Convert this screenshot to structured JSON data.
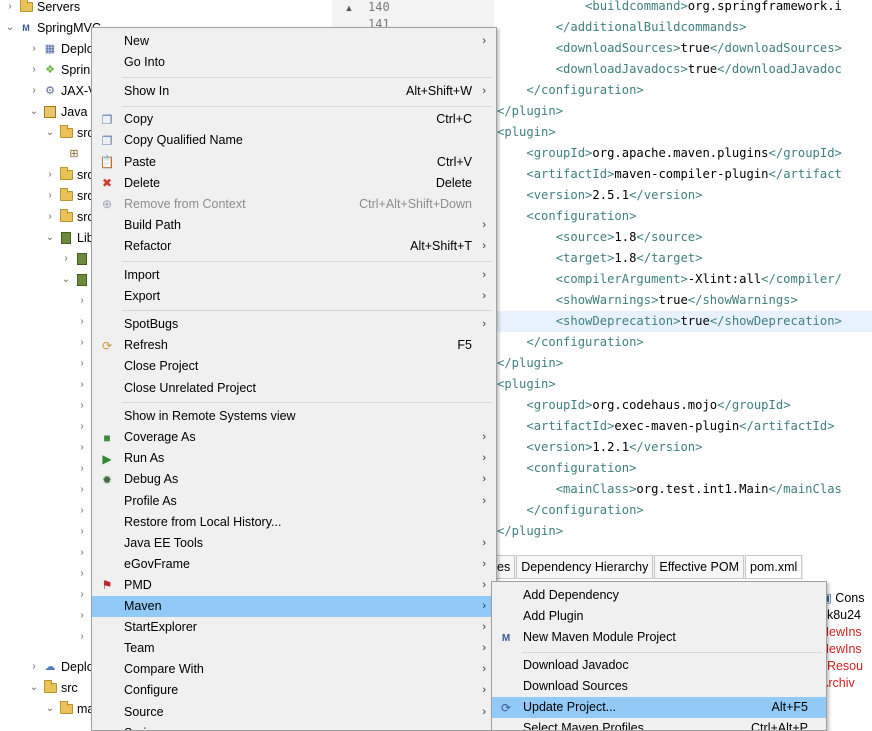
{
  "explorer": {
    "rows": [
      {
        "label": "Servers",
        "icon": "folder-icon"
      },
      {
        "label": "SpringMVC",
        "icon": "maven-project-icon"
      },
      {
        "label": "Deplo",
        "icon": "deployment-icon"
      },
      {
        "label": "Sprin",
        "icon": "spring-icon"
      },
      {
        "label": "JAX-V",
        "icon": "jaxws-icon"
      },
      {
        "label": "Java I",
        "icon": "java-resources-icon"
      },
      {
        "label": "src",
        "icon": "source-folder-icon"
      },
      {
        "label": "src",
        "icon": "source-folder-icon"
      },
      {
        "label": "src",
        "icon": "source-folder-icon"
      },
      {
        "label": "src",
        "icon": "source-folder-icon"
      },
      {
        "label": "Lib",
        "icon": "libraries-icon"
      },
      {
        "label": "Deplo",
        "icon": "deployed-resources-icon"
      },
      {
        "label": "src",
        "icon": "folder-icon"
      },
      {
        "label": "ma",
        "icon": "folder-icon"
      }
    ]
  },
  "editor": {
    "line_numbers": [
      "140",
      "141"
    ],
    "code_lines": [
      {
        "indent": "            ",
        "tag_open": "<buildcommand>",
        "text": "org.springframework.i",
        "tag_close": ""
      },
      {
        "indent": "        ",
        "tag_open": "</additionalBuildcommands>",
        "text": "",
        "tag_close": ""
      },
      {
        "indent": "        ",
        "tag_open": "<downloadSources>",
        "text": "true",
        "tag_close": "</downloadSources>"
      },
      {
        "indent": "        ",
        "tag_open": "<downloadJavadocs>",
        "text": "true",
        "tag_close": "</downloadJavadoc"
      },
      {
        "indent": "    ",
        "tag_open": "</configuration>",
        "text": "",
        "tag_close": ""
      },
      {
        "indent": "",
        "tag_open": "</plugin>",
        "text": "",
        "tag_close": ""
      },
      {
        "indent": "",
        "tag_open": "<plugin>",
        "text": "",
        "tag_close": ""
      },
      {
        "indent": "    ",
        "tag_open": "<groupId>",
        "text": "org.apache.maven.plugins",
        "tag_close": "</groupId>"
      },
      {
        "indent": "    ",
        "tag_open": "<artifactId>",
        "text": "maven-compiler-plugin",
        "tag_close": "</artifact"
      },
      {
        "indent": "    ",
        "tag_open": "<version>",
        "text": "2.5.1",
        "tag_close": "</version>"
      },
      {
        "indent": "    ",
        "tag_open": "<configuration>",
        "text": "",
        "tag_close": ""
      },
      {
        "indent": "        ",
        "tag_open": "<source>",
        "text": "1.8",
        "tag_close": "</source>"
      },
      {
        "indent": "        ",
        "tag_open": "<target>",
        "text": "1.8",
        "tag_close": "</target>"
      },
      {
        "indent": "        ",
        "tag_open": "<compilerArgument>",
        "text": "-Xlint:all",
        "tag_close": "</compiler/"
      },
      {
        "indent": "        ",
        "tag_open": "<showWarnings>",
        "text": "true",
        "tag_close": "</showWarnings>"
      },
      {
        "indent": "        ",
        "tag_open": "<showDeprecation>",
        "text": "true",
        "tag_close": "</showDeprecation>"
      },
      {
        "indent": "    ",
        "tag_open": "</configuration>",
        "text": "",
        "tag_close": ""
      },
      {
        "indent": "",
        "tag_open": "</plugin>",
        "text": "",
        "tag_close": ""
      },
      {
        "indent": "",
        "tag_open": "<plugin>",
        "text": "",
        "tag_close": ""
      },
      {
        "indent": "    ",
        "tag_open": "<groupId>",
        "text": "org.codehaus.mojo",
        "tag_close": "</groupId>"
      },
      {
        "indent": "    ",
        "tag_open": "<artifactId>",
        "text": "exec-maven-plugin",
        "tag_close": "</artifactId>"
      },
      {
        "indent": "    ",
        "tag_open": "<version>",
        "text": "1.2.1",
        "tag_close": "</version>"
      },
      {
        "indent": "    ",
        "tag_open": "<configuration>",
        "text": "",
        "tag_close": ""
      },
      {
        "indent": "        ",
        "tag_open": "<mainClass>",
        "text": "org.test.int1.Main",
        "tag_close": "</mainClas"
      },
      {
        "indent": "    ",
        "tag_open": "</configuration>",
        "text": "",
        "tag_close": ""
      },
      {
        "indent": "",
        "tag_open": "</plugin>",
        "text": "",
        "tag_close": ""
      },
      {
        "indent": "",
        "tag_open": "ugins>",
        "text": "",
        "tag_close": ""
      }
    ],
    "highlighted_line": 15,
    "pom_tabs": [
      "es",
      "Dependency Hierarchy",
      "Effective POM",
      "pom.xml"
    ],
    "active_pom_tab": 3
  },
  "console": {
    "title": "Cons",
    "lines": [
      {
        "text": "dk8u24",
        "red": false
      },
      {
        "text": "NewIns",
        "red": true
      },
      {
        "text": "NewIns",
        "red": true
      },
      {
        "text": "eResou",
        "red": true
      },
      {
        "text": "Archiv",
        "red": true
      }
    ]
  },
  "context_menu": {
    "items": [
      {
        "label": "New",
        "accel": "",
        "submenu": true,
        "icon": "",
        "disabled": false
      },
      {
        "label": "Go Into",
        "accel": "",
        "submenu": false,
        "icon": "",
        "disabled": false
      },
      {
        "sep": true
      },
      {
        "label": "Show In",
        "accel": "Alt+Shift+W",
        "submenu": true,
        "icon": "",
        "disabled": false
      },
      {
        "sep": true
      },
      {
        "label": "Copy",
        "accel": "Ctrl+C",
        "submenu": false,
        "icon": "copy-icon",
        "disabled": false
      },
      {
        "label": "Copy Qualified Name",
        "accel": "",
        "submenu": false,
        "icon": "copy-qualified-icon",
        "disabled": false
      },
      {
        "label": "Paste",
        "accel": "Ctrl+V",
        "submenu": false,
        "icon": "paste-icon",
        "disabled": false
      },
      {
        "label": "Delete",
        "accel": "Delete",
        "submenu": false,
        "icon": "delete-icon",
        "disabled": false
      },
      {
        "label": "Remove from Context",
        "accel": "Ctrl+Alt+Shift+Down",
        "submenu": false,
        "icon": "remove-context-icon",
        "disabled": true
      },
      {
        "label": "Build Path",
        "accel": "",
        "submenu": true,
        "icon": "",
        "disabled": false
      },
      {
        "label": "Refactor",
        "accel": "Alt+Shift+T",
        "submenu": true,
        "icon": "",
        "disabled": false
      },
      {
        "sep": true
      },
      {
        "label": "Import",
        "accel": "",
        "submenu": true,
        "icon": "",
        "disabled": false
      },
      {
        "label": "Export",
        "accel": "",
        "submenu": true,
        "icon": "",
        "disabled": false
      },
      {
        "sep": true
      },
      {
        "label": "SpotBugs",
        "accel": "",
        "submenu": true,
        "icon": "",
        "disabled": false
      },
      {
        "label": "Refresh",
        "accel": "F5",
        "submenu": false,
        "icon": "refresh-icon",
        "disabled": false
      },
      {
        "label": "Close Project",
        "accel": "",
        "submenu": false,
        "icon": "",
        "disabled": false
      },
      {
        "label": "Close Unrelated Project",
        "accel": "",
        "submenu": false,
        "icon": "",
        "disabled": false
      },
      {
        "sep": true
      },
      {
        "label": "Show in Remote Systems view",
        "accel": "",
        "submenu": false,
        "icon": "",
        "disabled": false
      },
      {
        "label": "Coverage As",
        "accel": "",
        "submenu": true,
        "icon": "coverage-icon",
        "disabled": false
      },
      {
        "label": "Run As",
        "accel": "",
        "submenu": true,
        "icon": "run-icon",
        "disabled": false
      },
      {
        "label": "Debug As",
        "accel": "",
        "submenu": true,
        "icon": "debug-icon",
        "disabled": false
      },
      {
        "label": "Profile As",
        "accel": "",
        "submenu": true,
        "icon": "",
        "disabled": false
      },
      {
        "label": "Restore from Local History...",
        "accel": "",
        "submenu": false,
        "icon": "",
        "disabled": false
      },
      {
        "label": "Java EE Tools",
        "accel": "",
        "submenu": true,
        "icon": "",
        "disabled": false
      },
      {
        "label": "eGovFrame",
        "accel": "",
        "submenu": true,
        "icon": "",
        "disabled": false
      },
      {
        "label": "PMD",
        "accel": "",
        "submenu": true,
        "icon": "pmd-icon",
        "disabled": false
      },
      {
        "label": "Maven",
        "accel": "",
        "submenu": true,
        "icon": "",
        "disabled": false,
        "selected": true
      },
      {
        "label": "StartExplorer",
        "accel": "",
        "submenu": true,
        "icon": "",
        "disabled": false
      },
      {
        "label": "Team",
        "accel": "",
        "submenu": true,
        "icon": "",
        "disabled": false
      },
      {
        "label": "Compare With",
        "accel": "",
        "submenu": true,
        "icon": "",
        "disabled": false
      },
      {
        "label": "Configure",
        "accel": "",
        "submenu": true,
        "icon": "",
        "disabled": false
      },
      {
        "label": "Source",
        "accel": "",
        "submenu": true,
        "icon": "",
        "disabled": false
      },
      {
        "label": "Spring",
        "accel": "",
        "submenu": true,
        "icon": "spring-leaf-icon",
        "disabled": false
      }
    ]
  },
  "maven_submenu": {
    "items": [
      {
        "label": "Add Dependency",
        "accel": "",
        "icon": ""
      },
      {
        "label": "Add Plugin",
        "accel": "",
        "icon": ""
      },
      {
        "label": "New Maven Module Project",
        "accel": "",
        "icon": "maven-module-icon"
      },
      {
        "sep": true
      },
      {
        "label": "Download Javadoc",
        "accel": "",
        "icon": ""
      },
      {
        "label": "Download Sources",
        "accel": "",
        "icon": ""
      },
      {
        "label": "Update Project...",
        "accel": "Alt+F5",
        "icon": "update-project-icon",
        "selected": true
      },
      {
        "label": "Select Maven Profiles...",
        "accel": "Ctrl+Alt+P",
        "icon": ""
      }
    ]
  },
  "colors": {
    "menu_bg": "#f0f0f0",
    "selection": "#91c9f7",
    "xml_tag": "#3f7f7f",
    "console_error": "#d32020"
  }
}
